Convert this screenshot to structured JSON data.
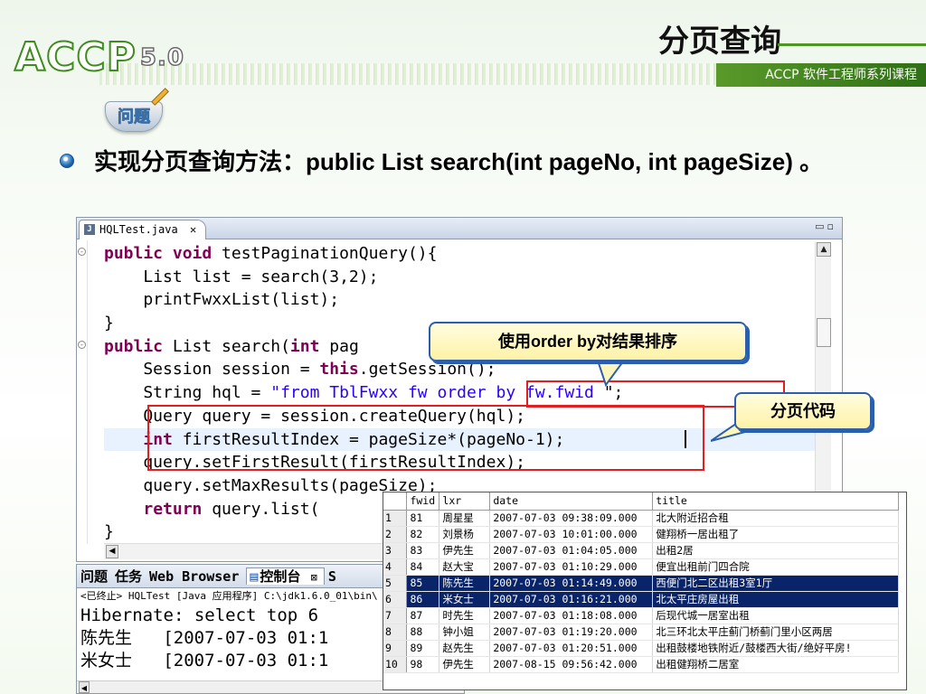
{
  "slide": {
    "title": "分页查询",
    "logo_text": "ACCP",
    "logo_version": "5.0",
    "subtitle": "ACCP 软件工程师系列课程",
    "badge": "问题",
    "bullet": "实现分页查询方法：public List search(int pageNo, int pageSize) 。"
  },
  "editor": {
    "tab_label": "HQLTest.java",
    "tab_close": "✕",
    "window_controls": "▭▫",
    "scroll_up": "▲",
    "scroll_left": "◀",
    "code_lines": [
      [
        {
          "t": "public void ",
          "c": "kw"
        },
        {
          "t": "testPaginationQuery(){"
        }
      ],
      [
        {
          "t": "    List list = search(3,2);"
        }
      ],
      [
        {
          "t": "    printFwxxList(list);"
        }
      ],
      [
        {
          "t": "}"
        }
      ],
      [
        {
          "t": "public ",
          "c": "kw"
        },
        {
          "t": "List search("
        },
        {
          "t": "int ",
          "c": "kw"
        },
        {
          "t": "pag"
        }
      ],
      [
        {
          "t": "    Session session = "
        },
        {
          "t": "this",
          "c": "kw"
        },
        {
          "t": ".getSession();"
        }
      ],
      [
        {
          "t": "    String hql = "
        },
        {
          "t": "\"from TblFwxx fw order by fw.fwid ",
          "c": "str"
        },
        {
          "t": "\";"
        }
      ],
      [
        {
          "t": "    Query query = session.createQuery(hql);"
        }
      ],
      [
        {
          "t": "    "
        },
        {
          "t": "int ",
          "c": "kw"
        },
        {
          "t": "firstResultIndex = pageSize*(pageNo-1);"
        }
      ],
      [
        {
          "t": "    query.setFirstResult(firstResultIndex);"
        }
      ],
      [
        {
          "t": "    query.setMaxResults(pageSize);"
        }
      ],
      [
        {
          "t": "    "
        },
        {
          "t": "return ",
          "c": "kw"
        },
        {
          "t": "query.list("
        }
      ],
      [
        {
          "t": "}"
        }
      ]
    ],
    "highlight_line": 8
  },
  "callouts": {
    "order_by": "使用order by对结果排序",
    "paging_code": "分页代码"
  },
  "console": {
    "tabs": [
      "问题",
      "任务",
      "Web Browser",
      "控制台",
      "S"
    ],
    "active_tab": "控制台",
    "active_tab_icon": "console-icon",
    "status": "<已终止> HQLTest [Java 应用程序] C:\\jdk1.6.0_01\\bin\\",
    "output": [
      "Hibernate: select top 6 ",
      "陈先生   [2007-07-03 01:1",
      "米女士   [2007-07-03 01:1"
    ],
    "scroll_left": "◀"
  },
  "grid": {
    "columns": [
      "fwid",
      "lxr",
      "date",
      "title"
    ],
    "selected_rows": [
      4,
      5
    ],
    "selection_color": "#0a246a",
    "rows": [
      [
        "1",
        "81",
        "周星星",
        "2007-07-03 09:38:09.000",
        "北大附近招合租"
      ],
      [
        "2",
        "82",
        "刘景杨",
        "2007-07-03 10:01:00.000",
        "健翔桥一居出租了"
      ],
      [
        "3",
        "83",
        "伊先生",
        "2007-07-03 01:04:05.000",
        "出租2居"
      ],
      [
        "4",
        "84",
        "赵大宝",
        "2007-07-03 01:10:29.000",
        "便宜出租前门四合院"
      ],
      [
        "5",
        "85",
        "陈先生",
        "2007-07-03 01:14:49.000",
        "西便门北二区出租3室1厅"
      ],
      [
        "6",
        "86",
        "米女士",
        "2007-07-03 01:16:21.000",
        "北太平庄房屋出租"
      ],
      [
        "7",
        "87",
        "时先生",
        "2007-07-03 01:18:08.000",
        "后现代城一居室出租"
      ],
      [
        "8",
        "88",
        "钟小姐",
        "2007-07-03 01:19:20.000",
        "北三环北太平庄蓟门桥蓟门里小区两居"
      ],
      [
        "9",
        "89",
        "赵先生",
        "2007-07-03 01:20:51.000",
        "出租鼓楼地铁附近/鼓楼西大街/绝好平房!"
      ],
      [
        "10",
        "98",
        "伊先生",
        "2007-08-15 09:56:42.000",
        "出租健翔桥二居室"
      ]
    ]
  },
  "colors": {
    "keyword": "#7f0055",
    "string": "#2a00ff",
    "annotation_red": "#e02020",
    "callout_border": "#2b5fae",
    "brand_green": "#3f8c1e"
  }
}
